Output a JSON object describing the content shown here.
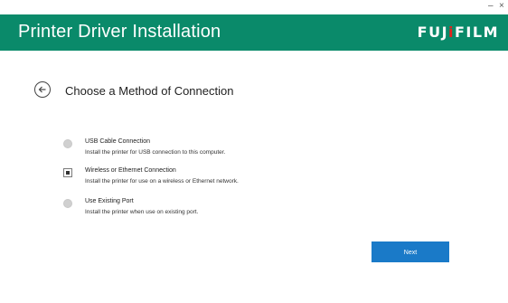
{
  "window": {
    "minimize_glyph": "–",
    "close_glyph": "×"
  },
  "header": {
    "title": "Printer Driver Installation",
    "brand": "FUJIFILM",
    "brand_parts": [
      "FUJ",
      "i",
      "FILM"
    ],
    "background_color": "#0a8a6a",
    "brand_dot_color": "#e2211c"
  },
  "page": {
    "back_icon": "back-arrow-circle-icon",
    "heading": "Choose a Method of Connection"
  },
  "options": [
    {
      "title": "USB Cable Connection",
      "description": "Install the printer for USB connection to this computer.",
      "selected": false
    },
    {
      "title": "Wireless or Ethernet Connection",
      "description": "Install the printer for use on a wireless or Ethernet network.",
      "selected": true
    },
    {
      "title": "Use Existing Port",
      "description": "Install the printer when use on existing port.",
      "selected": false
    }
  ],
  "footer": {
    "next_label": "Next",
    "next_color": "#1a7ac8"
  }
}
